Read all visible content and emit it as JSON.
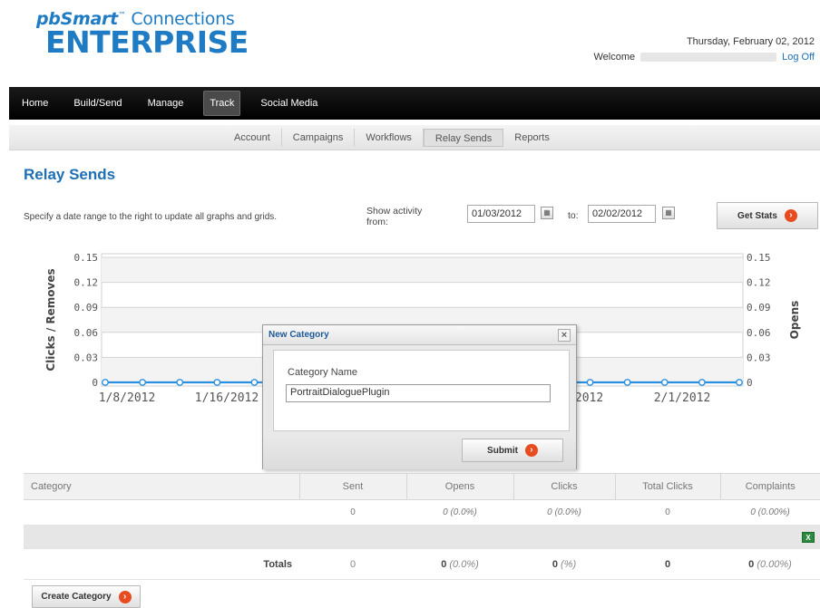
{
  "logo": {
    "brand": "pbSmart",
    "tm": "™",
    "product": "Connections",
    "edition": "ENTERPRISE"
  },
  "header": {
    "date": "Thursday, February 02, 2012",
    "welcome": "Welcome",
    "logoff": "Log Off"
  },
  "main_nav": [
    "Home",
    "Build/Send",
    "Manage",
    "Track",
    "Social Media"
  ],
  "main_nav_active": "Track",
  "sub_nav": [
    "Account",
    "Campaigns",
    "Workflows",
    "Relay Sends",
    "Reports"
  ],
  "sub_nav_active": "Relay Sends",
  "page_title": "Relay Sends",
  "filter": {
    "instructions": "Specify a date range to the right to update all graphs and grids.",
    "show_activity": "Show activity from:",
    "from_date": "01/03/2012",
    "to_label": "to:",
    "to_date": "02/02/2012",
    "get_stats": "Get Stats"
  },
  "chart_data": {
    "type": "line",
    "ylabel_left": "Clicks / Removes",
    "ylabel_right": "Opens",
    "y_ticks": [
      "0.15",
      "0.12",
      "0.09",
      "0.06",
      "0.03",
      "0"
    ],
    "ylim": [
      0,
      0.15
    ],
    "x_tick_labels": [
      "1/8/2012",
      "1/16/2012",
      "1/24/2012",
      "2/1/2012"
    ],
    "series": [
      {
        "values": [
          0,
          0,
          0,
          0,
          0,
          0,
          0,
          0,
          0,
          0,
          0,
          0,
          0,
          0,
          0,
          0,
          0,
          0
        ],
        "color": "#2a8fe0"
      }
    ],
    "grid": true
  },
  "dialog": {
    "title": "New Category",
    "label": "Category Name",
    "value": "PortraitDialoguePlugin",
    "submit": "Submit"
  },
  "table": {
    "headers": [
      "Category",
      "Sent",
      "Opens",
      "Clicks",
      "Total Clicks",
      "Complaints"
    ],
    "row": {
      "category": "",
      "sent": "0",
      "opens": "0",
      "opens_pct": "(0.0%)",
      "clicks": "0",
      "clicks_pct": "(0.0%)",
      "total_clicks": "0",
      "complaints": "0",
      "complaints_pct": "(0.00%)"
    },
    "totals": {
      "label": "Totals",
      "sent": "0",
      "opens": "0",
      "opens_pct": "(0.0%)",
      "clicks": "0",
      "clicks_pct": "(%)",
      "total_clicks": "0",
      "complaints": "0",
      "complaints_pct": "(0.00%)"
    }
  },
  "create_category": "Create Category",
  "icons": {
    "arrow": "arrow-right-circle-icon",
    "calendar": "calendar-icon",
    "excel": "excel-export-icon",
    "close": "close-icon"
  }
}
